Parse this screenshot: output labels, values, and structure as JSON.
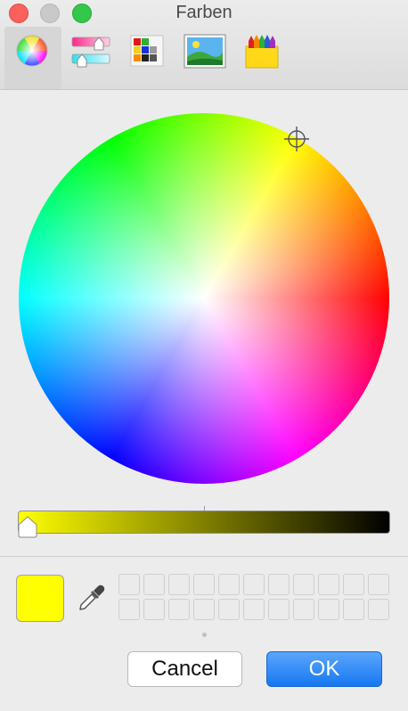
{
  "window": {
    "title": "Farben"
  },
  "toolbar": {
    "tabs": [
      {
        "icon": "color-wheel-icon",
        "selected": true
      },
      {
        "icon": "color-sliders-icon",
        "selected": false
      },
      {
        "icon": "color-palettes-icon",
        "selected": false
      },
      {
        "icon": "image-palettes-icon",
        "selected": false
      },
      {
        "icon": "pencils-icon",
        "selected": false
      }
    ]
  },
  "picker": {
    "selected_color": "#FFFF00",
    "brightness": 1.0
  },
  "buttons": {
    "cancel_label": "Cancel",
    "ok_label": "OK"
  },
  "colors": {
    "accent": "#1778F2",
    "swatch": "#FFFF00"
  }
}
